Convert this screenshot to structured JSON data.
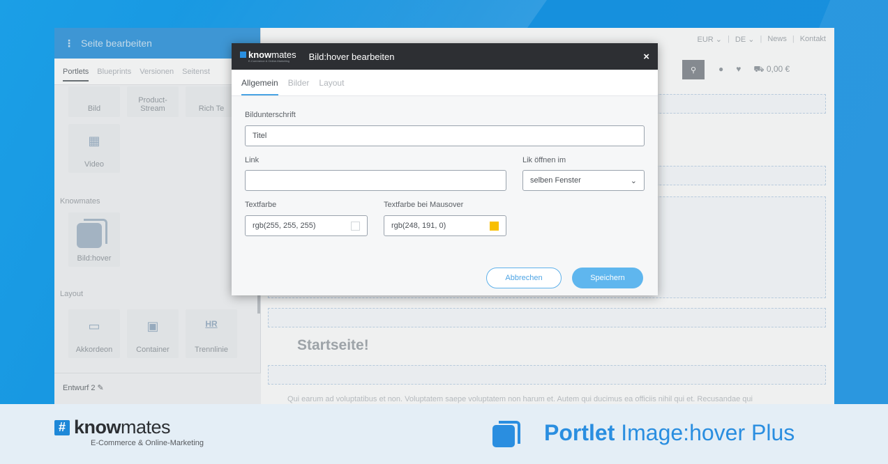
{
  "panel": {
    "title": "Seite bearbeiten",
    "tabs": [
      "Portlets",
      "Blueprints",
      "Versionen",
      "Seitenst"
    ],
    "tiles_row1": [
      "Bild",
      "Product-\nStream",
      "Rich Te"
    ],
    "video_label": "Video",
    "section_knowmates": "Knowmates",
    "bildhover_label": "Bild:hover",
    "section_layout": "Layout",
    "layout_tiles": [
      "Akkordeon",
      "Container",
      "Trennlinie"
    ],
    "hr_text": "HR",
    "draft_label": "Entwurf 2"
  },
  "store": {
    "nav": [
      "EUR",
      "DE",
      "News",
      "Kontakt"
    ],
    "cart_total": "0,00 €",
    "heading": "Startseite!",
    "paragraph": "Qui earum ad voluptatibus et non. Voluptatem saepe voluptatem non harum et. Autem qui ducimus ea officiis nihil qui et. Recusandae qui"
  },
  "modal": {
    "brand_word_bold": "know",
    "brand_word_light": "mates",
    "brand_sub": "E-Commerce & Online-Marketing",
    "title": "Bild:hover bearbeiten",
    "close_symbol": "×",
    "tabs": [
      "Allgemein",
      "Bilder",
      "Layout"
    ],
    "fields": {
      "caption_label": "Bildunterschrift",
      "caption_value": "Titel",
      "link_label": "Link",
      "link_value": "",
      "open_in_label": "Lik öffnen im",
      "open_in_value": "selben Fenster",
      "text_color_label": "Textfarbe",
      "text_color_value": "rgb(255, 255, 255)",
      "hover_color_label": "Textfarbe bei Mausover",
      "hover_color_value": "rgb(248, 191, 0)"
    },
    "swatch_colors": {
      "text": "#ffffff",
      "hover": "#f8bf00"
    },
    "cancel_label": "Abbrechen",
    "save_label": "Speichern"
  },
  "banner": {
    "hash": "#",
    "word_bold": "know",
    "word_light": "mates",
    "sub": "E-Commerce & Online-Marketing",
    "title_bold": "Portlet",
    "title_light": "Image:hover Plus"
  },
  "colors": {
    "accent": "#2a8ee0",
    "header_dark": "#2d2f33",
    "save_button": "#5fb6ee"
  }
}
